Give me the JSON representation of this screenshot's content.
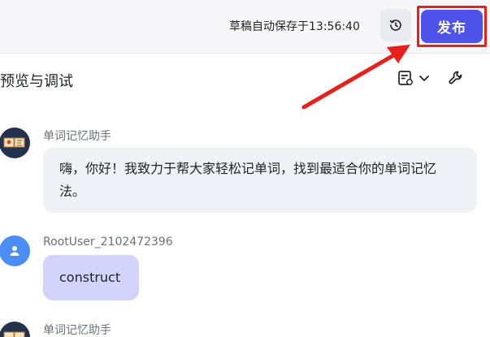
{
  "header": {
    "save_status": "草稿自动保存于13:56:40",
    "publish_label": "发布",
    "history_icon": "history-icon",
    "accent_color": "#4d53e8",
    "highlight_color": "#e8201b"
  },
  "preview": {
    "title": "预览与调试",
    "icons": [
      "document-icon",
      "chevron-down-icon",
      "wrench-icon"
    ]
  },
  "messages": [
    {
      "sender": "单词记忆助手",
      "role": "bot",
      "text": "嗨，你好！我致力于帮大家轻松记单词，找到最适合你的单词记忆法。"
    },
    {
      "sender": "RootUser_2102472396",
      "role": "user",
      "text": "construct"
    },
    {
      "sender": "单词记忆助手",
      "role": "bot",
      "text": ""
    }
  ]
}
